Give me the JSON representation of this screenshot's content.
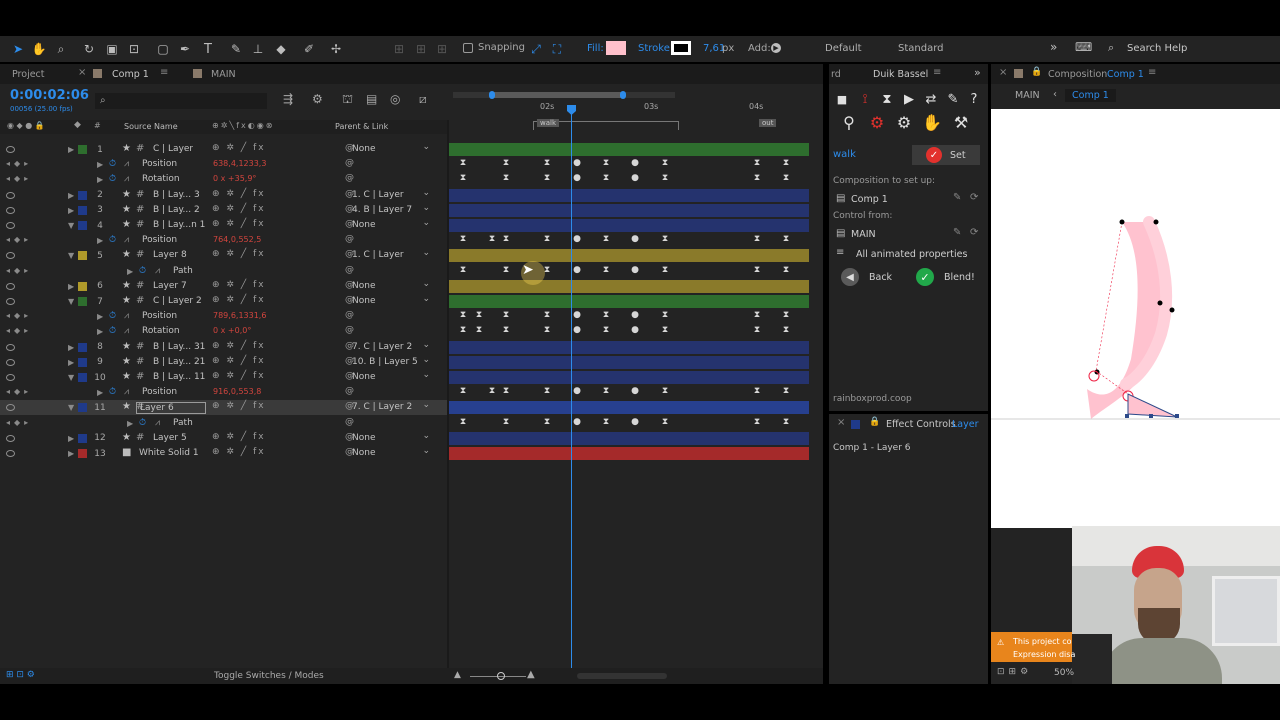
{
  "toolbar": {
    "snapping": "Snapping",
    "fill": "Fill:",
    "stroke": "Stroke:",
    "stroke_width": "7,61",
    "stroke_unit": "px",
    "add": "Add:",
    "workspace_default": "Default",
    "workspace_standard": "Standard",
    "search_help": "Search Help"
  },
  "tabs": {
    "project": "Project",
    "comp1": "Comp 1",
    "main": "MAIN",
    "duik_prefix": "rd",
    "duik": "Duik Bassel",
    "composition": "Composition",
    "composition_name": "Comp 1",
    "effect_controls": "Effect Controls",
    "effect_target": "Layer"
  },
  "timeline": {
    "timecode": "0:00:02:06",
    "frames": "00056 (25.00 fps)",
    "col_source": "Source Name",
    "col_parent": "Parent & Link",
    "ruler": [
      "02s",
      "03s",
      "04s"
    ],
    "marker_walk": "walk",
    "marker_out": "out",
    "footer": "Toggle Switches / Modes",
    "layers": [
      {
        "num": "1",
        "name": "C | Layer",
        "parent": "None"
      },
      {
        "prop": "Position",
        "value": "638,4,1233,3"
      },
      {
        "prop": "Rotation",
        "value": "0 x +35,9°"
      },
      {
        "num": "2",
        "name": "B | Lay... 3",
        "parent": "1. C | Layer"
      },
      {
        "num": "3",
        "name": "B | Lay... 2",
        "parent": "4. B | Layer 7"
      },
      {
        "num": "4",
        "name": "B | Lay...n 1",
        "parent": "None"
      },
      {
        "prop": "Position",
        "value": "764,0,552,5"
      },
      {
        "num": "5",
        "name": "Layer 8",
        "parent": "1. C | Layer"
      },
      {
        "prop": "Path",
        "value": ""
      },
      {
        "num": "6",
        "name": "Layer 7",
        "parent": "None"
      },
      {
        "num": "7",
        "name": "C | Layer 2",
        "parent": "None"
      },
      {
        "prop": "Position",
        "value": "789,6,1331,6"
      },
      {
        "prop": "Rotation",
        "value": "0 x +0,0°"
      },
      {
        "num": "8",
        "name": "B | Lay... 31",
        "parent": "7. C | Layer 2"
      },
      {
        "num": "9",
        "name": "B | Lay... 21",
        "parent": "10. B | Layer 5"
      },
      {
        "num": "10",
        "name": "B | Lay... 11",
        "parent": "None"
      },
      {
        "prop": "Position",
        "value": "916,0,553,8"
      },
      {
        "num": "11",
        "name": "Layer 6",
        "parent": "7. C | Layer 2"
      },
      {
        "prop": "Path",
        "value": ""
      },
      {
        "num": "12",
        "name": "Layer 5",
        "parent": "None"
      },
      {
        "num": "13",
        "name": "White Solid 1",
        "parent": "None"
      }
    ]
  },
  "duik": {
    "walk": "walk",
    "set": "Set",
    "comp_setup_label": "Composition to set up:",
    "comp_setup_value": "Comp 1",
    "control_from_label": "Control from:",
    "control_from_value": "MAIN",
    "animated_props": "All animated properties",
    "back": "Back",
    "blend": "Blend!",
    "footer": "rainboxprod.coop"
  },
  "effect": {
    "subtitle": "Comp 1 - Layer 6"
  },
  "comp": {
    "breadcrumb_main": "MAIN",
    "breadcrumb_comp": "Comp 1",
    "zoom": "50%",
    "warning_1": "This project co",
    "warning_2": "Expression disa"
  },
  "colors": {
    "accent": "#2d8ceb",
    "fill_swatch": "#ffc0cb",
    "track_green": "#2e6e2e",
    "track_blue": "#25336e",
    "track_yellow": "#8a7a2a",
    "track_red": "#a52a2a",
    "value_red": "#d2453e"
  }
}
